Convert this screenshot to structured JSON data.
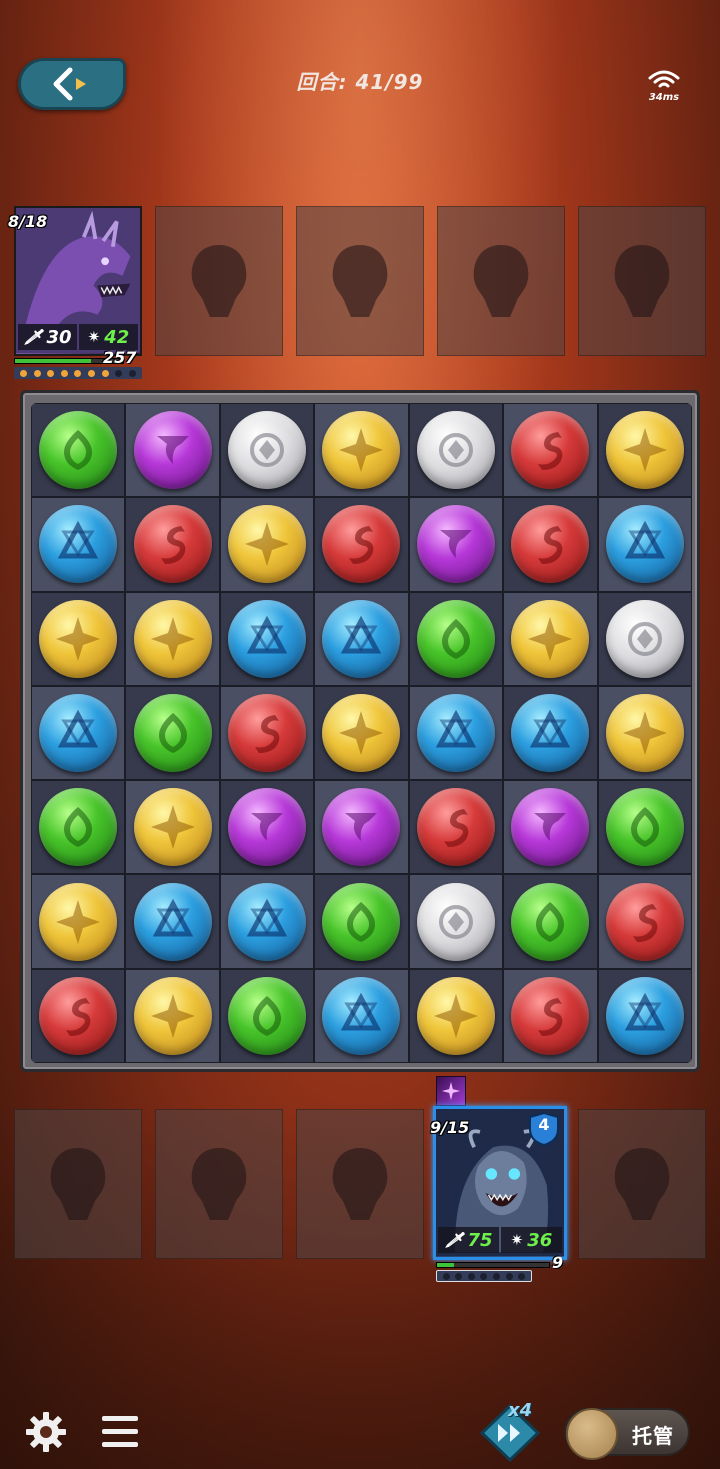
{
  "top_bar": {
    "round_text": "回合: 41/99",
    "ping_text": "34ms"
  },
  "enemy": {
    "card_count": "8/18",
    "attack": "30",
    "defense": "42",
    "hp": "257",
    "hp_fraction": 0.7,
    "charge_pips_total": 9,
    "charge_pips_filled": 7
  },
  "board": {
    "rows": [
      [
        "green",
        "purple",
        "white",
        "yellow",
        "white",
        "red",
        "yellow"
      ],
      [
        "blue",
        "red",
        "yellow",
        "red",
        "purple",
        "red",
        "blue"
      ],
      [
        "yellow",
        "yellow",
        "blue",
        "blue",
        "green",
        "yellow",
        "white"
      ],
      [
        "blue",
        "green",
        "red",
        "yellow",
        "blue",
        "blue",
        "yellow"
      ],
      [
        "green",
        "yellow",
        "purple",
        "purple",
        "red",
        "purple",
        "green"
      ],
      [
        "yellow",
        "blue",
        "blue",
        "green",
        "white",
        "green",
        "red"
      ],
      [
        "red",
        "yellow",
        "green",
        "blue",
        "yellow",
        "red",
        "blue"
      ]
    ],
    "colors": {
      "green": "#48c42a",
      "purple": "#b638d8",
      "white": "#dcdcdf",
      "yellow": "#efc53a",
      "red": "#d63a3a",
      "blue": "#2c9fe0"
    }
  },
  "hero": {
    "card_count": "9/15",
    "shield_value": "4",
    "attack": "75",
    "defense": "36",
    "hp": "9",
    "hp_fraction": 0.15,
    "charge_pips_total": 7,
    "charge_pips_filled": 0
  },
  "controls": {
    "speed_label": "x4",
    "auto_label": "托管"
  }
}
